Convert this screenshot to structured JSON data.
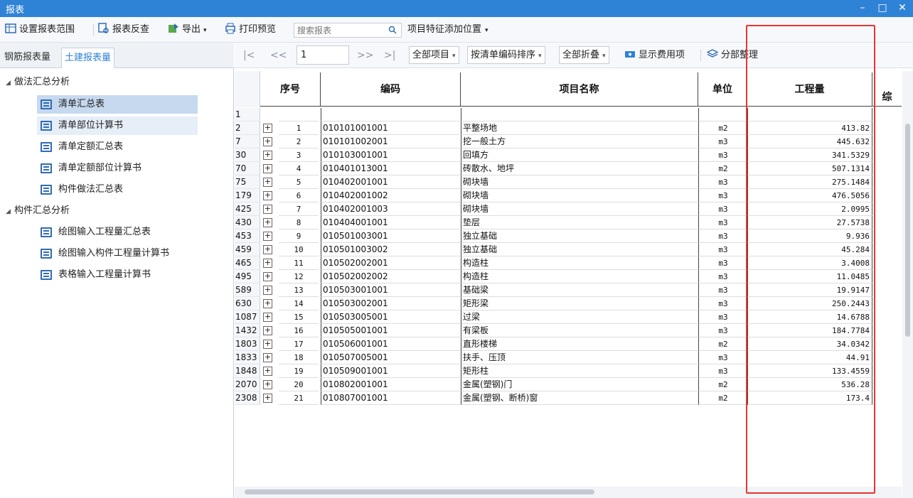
{
  "window": {
    "title": "报表",
    "minimize": "–",
    "maximize": "□",
    "close": "✕"
  },
  "toolbar": {
    "set_range": "设置报表范围",
    "reverse_check": "报表反查",
    "export": "导出",
    "print_preview": "打印预览",
    "search_placeholder": "搜索报表",
    "feature_position": "项目特征添加位置"
  },
  "left_tabs": [
    "钢筋报表量",
    "土建报表量"
  ],
  "active_tab": "土建报表量",
  "tree": {
    "groups": [
      {
        "label": "做法汇总分析",
        "items": [
          "清单汇总表",
          "清单部位计算书",
          "清单定额汇总表",
          "清单定额部位计算书",
          "构件做法汇总表"
        ]
      },
      {
        "label": "构件汇总分析",
        "items": [
          "绘图输入工程量汇总表",
          "绘图输入构件工程量计算书",
          "表格输入工程量计算书"
        ]
      }
    ],
    "selected": "清单汇总表"
  },
  "nav": {
    "first": "|<",
    "prev": "<<",
    "page": "1",
    "next": ">>",
    "last": ">|",
    "all_items": "全部项目",
    "sort": "按清单编码排序",
    "fold": "全部折叠",
    "show_cost": "显示费用项",
    "organize": "分部整理"
  },
  "columns": {
    "seq": "序号",
    "code": "编码",
    "name": "项目名称",
    "unit": "单位",
    "qty": "工程量",
    "extra": "综"
  },
  "rows": [
    {
      "id": "1",
      "seq": "",
      "code": "",
      "name": "",
      "unit": "",
      "qty": ""
    },
    {
      "id": "2",
      "seq": "1",
      "code": "010101001001",
      "name": "平整场地",
      "unit": "m2",
      "qty": "413.82"
    },
    {
      "id": "7",
      "seq": "2",
      "code": "010101002001",
      "name": "挖一般土方",
      "unit": "m3",
      "qty": "445.632"
    },
    {
      "id": "30",
      "seq": "3",
      "code": "010103001001",
      "name": "回填方",
      "unit": "m3",
      "qty": "341.5329"
    },
    {
      "id": "70",
      "seq": "4",
      "code": "010401013001",
      "name": "砖散水、地坪",
      "unit": "m2",
      "qty": "507.1314"
    },
    {
      "id": "75",
      "seq": "5",
      "code": "010402001001",
      "name": "砌块墙",
      "unit": "m3",
      "qty": "275.1484"
    },
    {
      "id": "179",
      "seq": "6",
      "code": "010402001002",
      "name": "砌块墙",
      "unit": "m3",
      "qty": "476.5056"
    },
    {
      "id": "425",
      "seq": "7",
      "code": "010402001003",
      "name": "砌块墙",
      "unit": "m3",
      "qty": "2.0995"
    },
    {
      "id": "430",
      "seq": "8",
      "code": "010404001001",
      "name": "垫层",
      "unit": "m3",
      "qty": "27.5738"
    },
    {
      "id": "453",
      "seq": "9",
      "code": "010501003001",
      "name": "独立基础",
      "unit": "m3",
      "qty": "9.936"
    },
    {
      "id": "459",
      "seq": "10",
      "code": "010501003002",
      "name": "独立基础",
      "unit": "m3",
      "qty": "45.284"
    },
    {
      "id": "465",
      "seq": "11",
      "code": "010502002001",
      "name": "构造柱",
      "unit": "m3",
      "qty": "3.4008"
    },
    {
      "id": "495",
      "seq": "12",
      "code": "010502002002",
      "name": "构造柱",
      "unit": "m3",
      "qty": "11.0485"
    },
    {
      "id": "589",
      "seq": "13",
      "code": "010503001001",
      "name": "基础梁",
      "unit": "m3",
      "qty": "19.9147"
    },
    {
      "id": "630",
      "seq": "14",
      "code": "010503002001",
      "name": "矩形梁",
      "unit": "m3",
      "qty": "250.2443"
    },
    {
      "id": "1087",
      "seq": "15",
      "code": "010503005001",
      "name": "过梁",
      "unit": "m3",
      "qty": "14.6788"
    },
    {
      "id": "1432",
      "seq": "16",
      "code": "010505001001",
      "name": "有梁板",
      "unit": "m3",
      "qty": "184.7784"
    },
    {
      "id": "1803",
      "seq": "17",
      "code": "010506001001",
      "name": "直形楼梯",
      "unit": "m2",
      "qty": "34.0342"
    },
    {
      "id": "1833",
      "seq": "18",
      "code": "010507005001",
      "name": "扶手、压顶",
      "unit": "m3",
      "qty": "44.91"
    },
    {
      "id": "1848",
      "seq": "19",
      "code": "010509001001",
      "name": "矩形柱",
      "unit": "m3",
      "qty": "133.4559"
    },
    {
      "id": "2070",
      "seq": "20",
      "code": "010802001001",
      "name": "金属(塑钢)门",
      "unit": "m2",
      "qty": "536.28"
    },
    {
      "id": "2308",
      "seq": "21",
      "code": "010807001001",
      "name": "金属(塑钢、断桥)窗",
      "unit": "m2",
      "qty": "173.4"
    }
  ],
  "colors": {
    "titlebar": "#2f83d6",
    "highlight": "#e8352f",
    "selected_item": "#c6d9ee"
  }
}
